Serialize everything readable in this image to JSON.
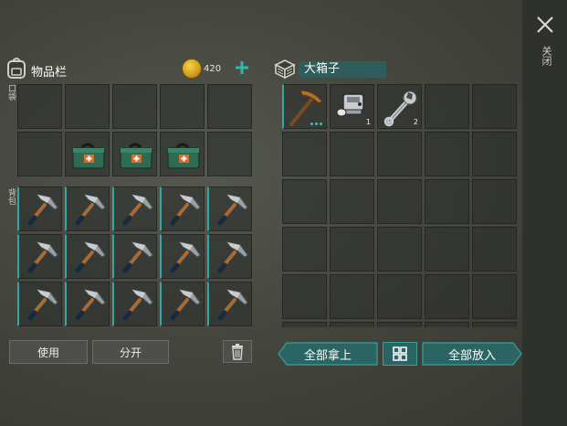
{
  "close": {
    "label": "关闭",
    "icon": "close-icon"
  },
  "inventory": {
    "title": "物品栏",
    "coins": "420",
    "pocket_label": "口袋",
    "backpack_label": "背包",
    "pocket_items": [
      "",
      "",
      "",
      "",
      "",
      "",
      "first-aid-kit",
      "first-aid-kit",
      "first-aid-kit",
      ""
    ],
    "backpack_items": [
      "pickaxe",
      "pickaxe",
      "pickaxe",
      "pickaxe",
      "pickaxe",
      "pickaxe",
      "pickaxe",
      "pickaxe",
      "pickaxe",
      "pickaxe",
      "pickaxe",
      "pickaxe",
      "pickaxe",
      "pickaxe",
      "pickaxe"
    ]
  },
  "actions": {
    "use": "使用",
    "split": "分开"
  },
  "chest": {
    "title": "大箱子",
    "items": [
      {
        "icon": "copper-pickaxe",
        "qty": ""
      },
      {
        "icon": "engine-part",
        "qty": "1"
      },
      {
        "icon": "wrench",
        "qty": "2"
      }
    ]
  },
  "transfer": {
    "take_all": "全部拿上",
    "put_all": "全部放入"
  },
  "colors": {
    "accent": "#2fa8a8",
    "button_teal": "#2a6563",
    "coin": "#e0b530"
  }
}
